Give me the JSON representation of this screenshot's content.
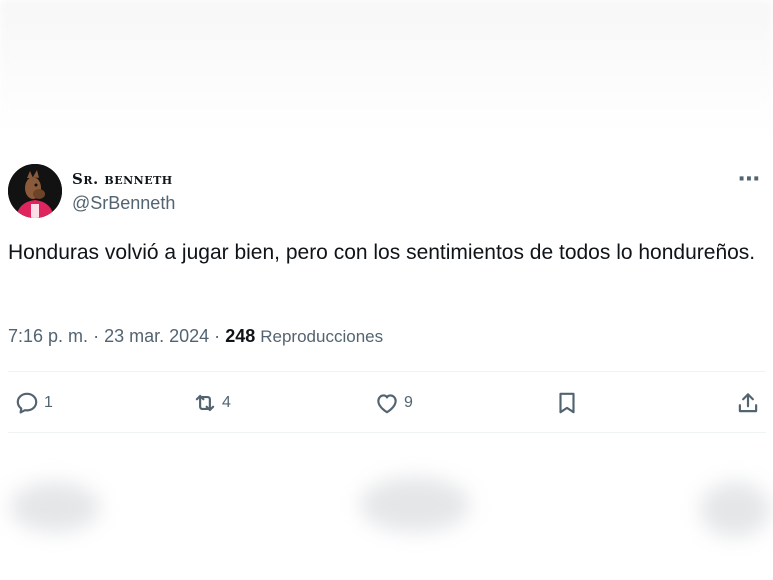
{
  "tweet": {
    "display_name": "Sr. benneth",
    "handle": "@SrBenneth",
    "more_icon": "⋯",
    "text": "Honduras volvió a jugar bien, pero con los sentimientos de todos lo hondureños.",
    "time": "7:16 p. m.",
    "date": "23 mar. 2024",
    "views_count": "248",
    "views_label": "Reproducciones",
    "separator": "·"
  },
  "actions": {
    "replies": "1",
    "retweets": "4",
    "likes": "9"
  },
  "colors": {
    "text": "#0f1419",
    "secondary": "#536471",
    "divider": "#eff3f4",
    "avatar_accent": "#e0245e"
  }
}
